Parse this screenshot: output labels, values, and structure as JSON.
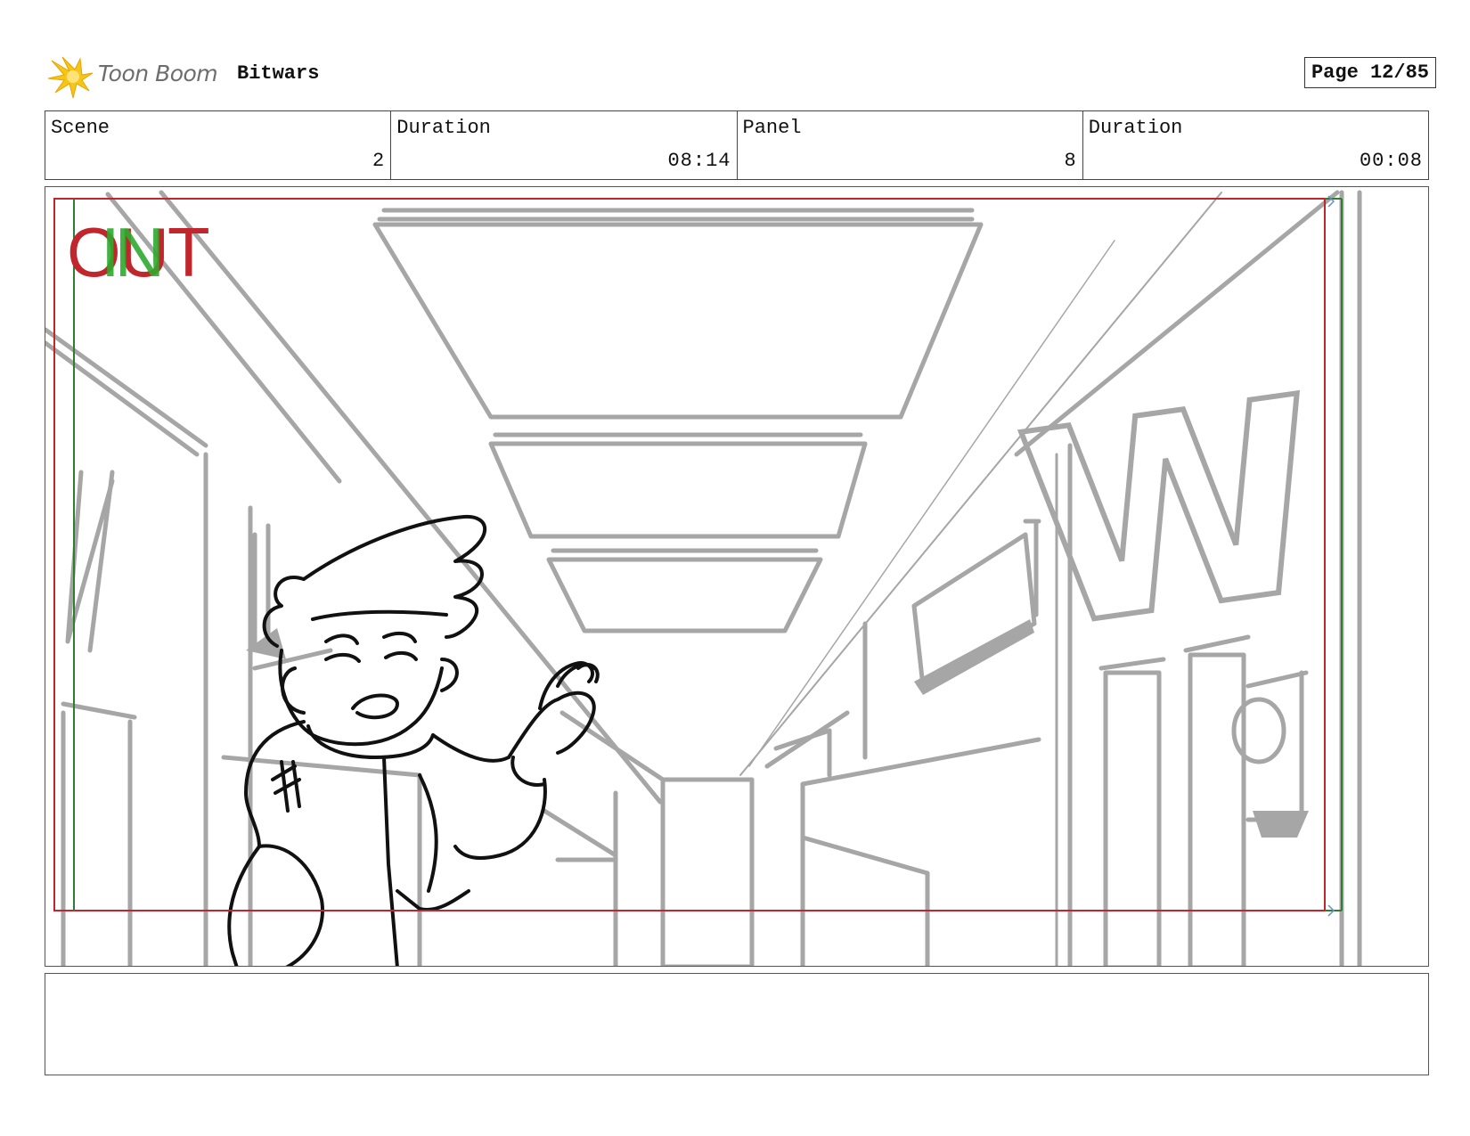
{
  "header": {
    "logo_text": "Toon Boom",
    "project_title": "Bitwars",
    "page_label": "Page 12/85"
  },
  "info": {
    "scene_label": "Scene",
    "scene_value": "2",
    "scene_duration_label": "Duration",
    "scene_duration_value": "08:14",
    "panel_label": "Panel",
    "panel_value": "8",
    "panel_duration_label": "Duration",
    "panel_duration_value": "00:08"
  },
  "panel": {
    "out_marker": "OUT",
    "in_marker": "IN",
    "sign_letter": "W",
    "colors": {
      "sketch": "#a6a6a6",
      "ink": "#111111",
      "safe_frame_red": "#c0262b",
      "safe_frame_green": "#2e7d32"
    }
  },
  "notes": {
    "text": ""
  }
}
